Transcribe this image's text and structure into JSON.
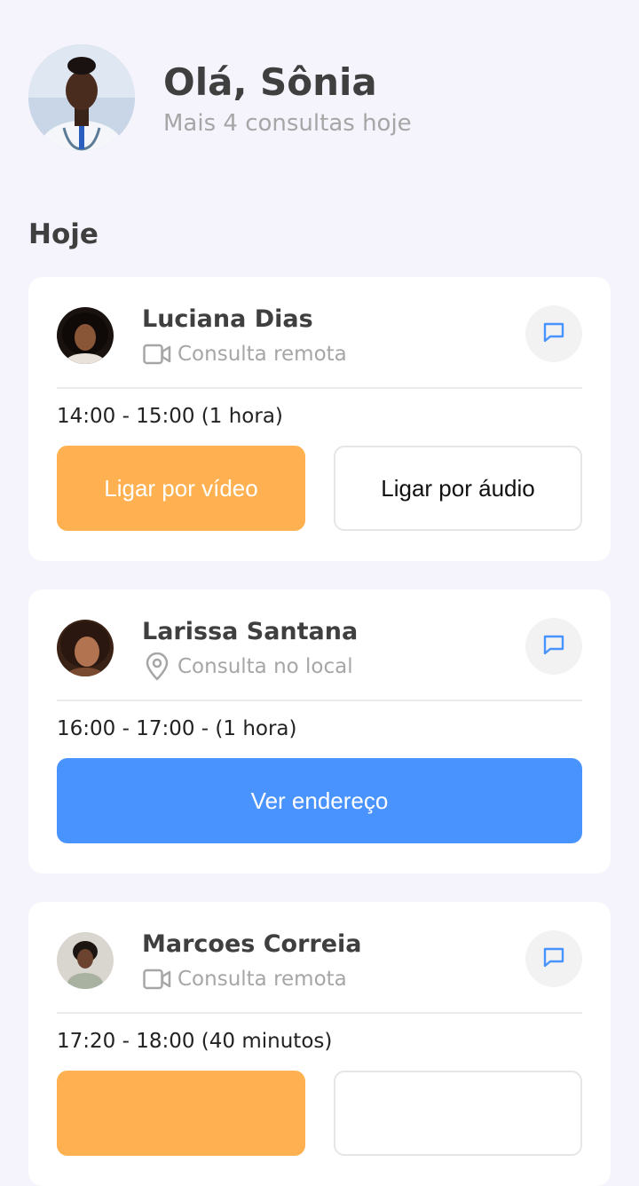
{
  "header": {
    "greeting": "Olá, Sônia",
    "subtitle": "Mais 4 consultas hoje"
  },
  "section_title": "Hoje",
  "appointments": [
    {
      "name": "Luciana Dias",
      "type": "Consulta remota",
      "type_icon": "video-icon",
      "time": "14:00 - 15:00 (1 hora)",
      "primary_label": "Ligar por vídeo",
      "secondary_label": "Ligar por áudio"
    },
    {
      "name": "Larissa Santana",
      "type": "Consulta no local",
      "type_icon": "location-pin-icon",
      "time": "16:00 - 17:00 - (1 hora)",
      "primary_label": "Ver endereço"
    },
    {
      "name": "Marcoes Correia",
      "type": "Consulta remota",
      "type_icon": "video-icon",
      "time": "17:20 - 18:00 (40 minutos)",
      "primary_label": "",
      "secondary_label": ""
    }
  ],
  "colors": {
    "background": "#f5f4fc",
    "video_button": "#ffb152",
    "address_button": "#4993ff",
    "chat_icon": "#4993ff"
  }
}
